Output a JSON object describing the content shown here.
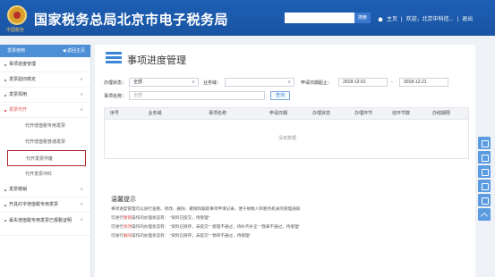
{
  "header": {
    "logo_sub": "中国税务",
    "title": "国家税务总局北京市电子税务局",
    "search_button": "搜索",
    "links": [
      "主页",
      "欢迎，北京中科信...",
      "退出"
    ],
    "separator": "|"
  },
  "sidebar": {
    "top_label": "发票使用",
    "back_label": "◀ 返回主页",
    "items": [
      {
        "label": "事项进度管理",
        "arrow": ""
      },
      {
        "label": "发票验旧核定",
        "arrow": "∨"
      },
      {
        "label": "发票领用",
        "arrow": "∨"
      },
      {
        "label": "发票代开",
        "arrow": "∧"
      },
      {
        "label": "代开增值税专用发票"
      },
      {
        "label": "代开增值税普通发票"
      },
      {
        "label": "代开发票作废"
      },
      {
        "label": "代开发票冲红"
      },
      {
        "label": "发票缴销",
        "arrow": "∨"
      },
      {
        "label": "开具红字增值税专用发票",
        "arrow": "∨"
      },
      {
        "label": "丢失增值税专用发票已报税证明",
        "arrow": "∨"
      }
    ]
  },
  "main": {
    "title": "事项进度管理",
    "filters": {
      "status_label": "办理状态：",
      "status_value": "全部",
      "business_label": "业务域：",
      "business_value": "",
      "date_label": "申请日期起止：",
      "date_from": "2018-12-01",
      "date_sep": "-",
      "date_to": "2018-12-21",
      "name_label": "事项名称：",
      "name_value": "全部",
      "query_button": "查询"
    },
    "table": {
      "headers": [
        "序号",
        "业务域",
        "事项名称",
        "申请日期",
        "办理状态",
        "办理环节",
        "信环节数",
        "办结期限"
      ],
      "empty_text": "没有数据"
    },
    "tips": {
      "title": "温馨提示",
      "lines": [
        {
          "pre": "",
          "key": "",
          "text": "事项进度管理可以进行查看、修改、删除、撤销和跟踪事项申请记录，便于纳税人和税务机关的受理通知"
        },
        {
          "pre": "可进行",
          "key": "撤销",
          "text": "操作的办理状态有：  \"资料已提交，待受理\""
        },
        {
          "pre": "可进行",
          "key": "修改",
          "text": "操作的办理状态有：  \"资料已保存，未提交\"   \"受理不通过，待补齐补正\"   \"我来不通过，待受理\""
        },
        {
          "pre": "可进行",
          "key": "删除",
          "text": "操作的办理状态有：  \"资料已保存，未提交\"   \"预审不通过，待受理\""
        }
      ]
    }
  },
  "colors": {
    "header_blue": "#1a54a3",
    "accent_blue": "#3b86d8",
    "alert_red": "#d9534f",
    "selected_border": "#a8282b"
  },
  "right_toolbar": [
    "help-icon",
    "chat-icon",
    "share-icon",
    "feedback-icon",
    "copy-icon",
    "back-to-top-icon"
  ]
}
